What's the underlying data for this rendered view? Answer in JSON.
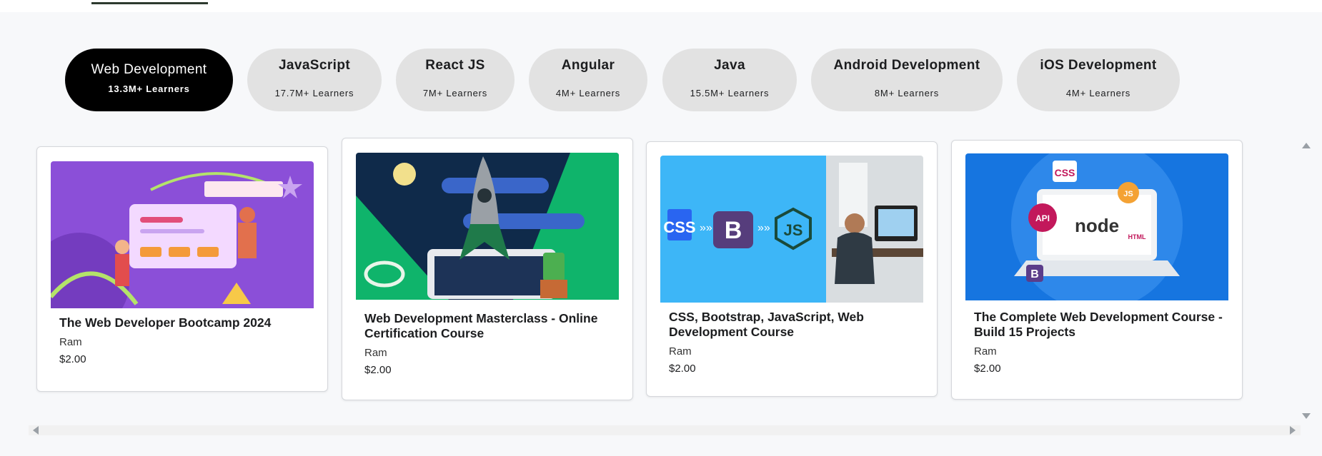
{
  "categories": [
    {
      "title": "Web Development",
      "learners": "13.3M+ Learners",
      "active": true
    },
    {
      "title": "JavaScript",
      "learners": "17.7M+ Learners"
    },
    {
      "title": "React JS",
      "learners": "7M+ Learners"
    },
    {
      "title": "Angular",
      "learners": "4M+ Learners"
    },
    {
      "title": "Java",
      "learners": "15.5M+ Learners"
    },
    {
      "title": "Android Development",
      "learners": "8M+ Learners"
    },
    {
      "title": "iOS Development",
      "learners": "4M+ Learners"
    }
  ],
  "courses": [
    {
      "title": "The Web Developer Bootcamp 2024",
      "author": "Ram",
      "price": "$2.00"
    },
    {
      "title": "Web Development Masterclass - Online Certification Course",
      "author": "Ram",
      "price": "$2.00"
    },
    {
      "title": "CSS, Bootstrap, JavaScript, Web Development Course",
      "author": "Ram",
      "price": "$2.00",
      "thumb_badges": [
        "CSS",
        "B",
        "JS"
      ]
    },
    {
      "title": "The Complete Web Development Course - Build 15 Projects",
      "author": "Ram",
      "price": "$2.00",
      "thumb_badges": [
        "CSS",
        "JS",
        "API",
        "node",
        "HTML",
        "B"
      ]
    }
  ],
  "colors": {
    "active_pill": "#000000",
    "inactive_pill": "#e2e2e2",
    "page_bg": "#f7f8fa"
  }
}
